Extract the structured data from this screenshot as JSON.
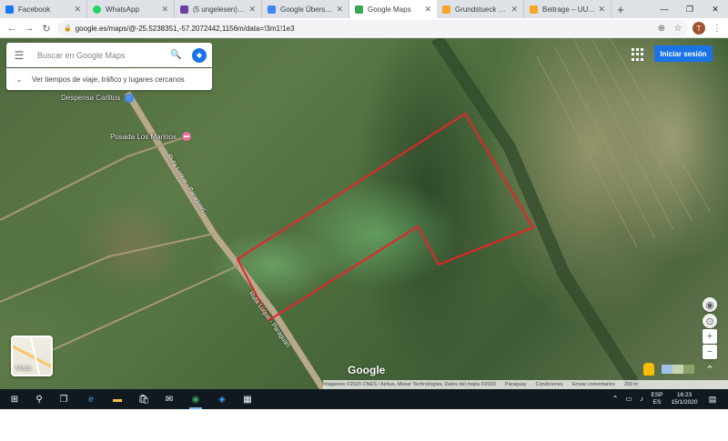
{
  "tabs": [
    {
      "label": "Facebook",
      "color": "#1877f2"
    },
    {
      "label": "WhatsApp",
      "color": "#25d366"
    },
    {
      "label": "(5 ungelesen) – ti…",
      "color": "#6d3fa0"
    },
    {
      "label": "Google Übersetzer",
      "color": "#4285f4"
    },
    {
      "label": "Google Maps",
      "color": "#34a853"
    },
    {
      "label": "Grundstueck mit 2…",
      "color": "#f5a623"
    },
    {
      "label": "Beitrage – UUSA –",
      "color": "#f5a623"
    }
  ],
  "browser": {
    "url": "google.es/maps/@-25.5238351,-57.2072442,1156m/data=!3m1!1e3",
    "profile_initial": "T"
  },
  "maps": {
    "search_placeholder": "Buscar en Google Maps",
    "traffic_text": "Ver tiempos de viaje, tráfico y lugares cercanos",
    "signin_label": "Iniciar sesión",
    "layers_label": "Mapa",
    "logo": "Google",
    "places": [
      {
        "name": "Despensa Carlitos"
      },
      {
        "name": "Posada Los Marinos"
      }
    ],
    "road_labels": [
      "Ruta Luque - Paraguarí",
      "Ruta Luque - Paraguarí"
    ],
    "attribution": [
      "Imágenes ©2020 CNES / Airbus, Maxar Technologies, Datos del mapa ©2020",
      "Paraguay",
      "Condiciones",
      "Enviar comentarios",
      "200 m"
    ],
    "boundary_color": "#e8232a"
  },
  "taskbar": {
    "lang_top": "ESP",
    "lang_bottom": "ES",
    "time": "16:23",
    "date": "15/1/2020"
  }
}
